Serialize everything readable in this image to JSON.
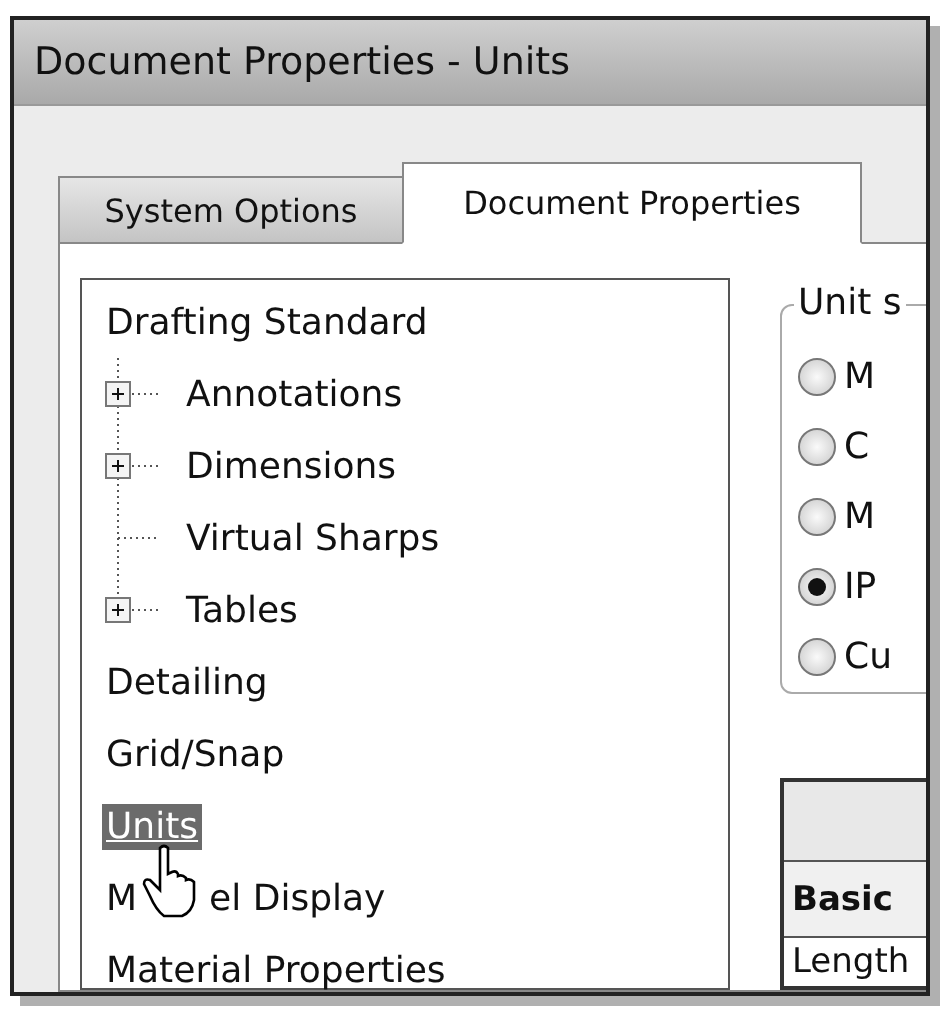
{
  "window": {
    "title": "Document Properties - Units"
  },
  "tabs": [
    {
      "label": "System Options",
      "selected": false
    },
    {
      "label": "Document Properties",
      "selected": true
    }
  ],
  "tree": [
    {
      "label": "Drafting Standard",
      "selected": false,
      "children": [
        {
          "label": "Annotations",
          "selected": false,
          "expanded": false
        },
        {
          "label": "Dimensions",
          "selected": false,
          "expanded": false
        },
        {
          "label": "Virtual Sharps",
          "selected": false
        },
        {
          "label": "Tables",
          "selected": false,
          "expanded": false
        }
      ]
    },
    {
      "label": "Detailing",
      "selected": false
    },
    {
      "label": "Grid/Snap",
      "selected": false
    },
    {
      "label": "Units",
      "selected": true
    },
    {
      "label_parts": [
        "M",
        "el Display"
      ],
      "selected": false
    },
    {
      "label": "Material Properties",
      "selected": false
    }
  ],
  "unit_system": {
    "title": "Unit s",
    "options": [
      {
        "label": "M",
        "selected": false
      },
      {
        "label": "C",
        "selected": false
      },
      {
        "label": "M",
        "selected": false
      },
      {
        "label": "IP",
        "selected": true
      },
      {
        "label": "Cu",
        "selected": false
      }
    ]
  },
  "table": {
    "rows": [
      {
        "kind": "header",
        "cell": ""
      },
      {
        "kind": "group",
        "cell": "Basic"
      },
      {
        "kind": "row",
        "cell": "Length"
      }
    ]
  }
}
